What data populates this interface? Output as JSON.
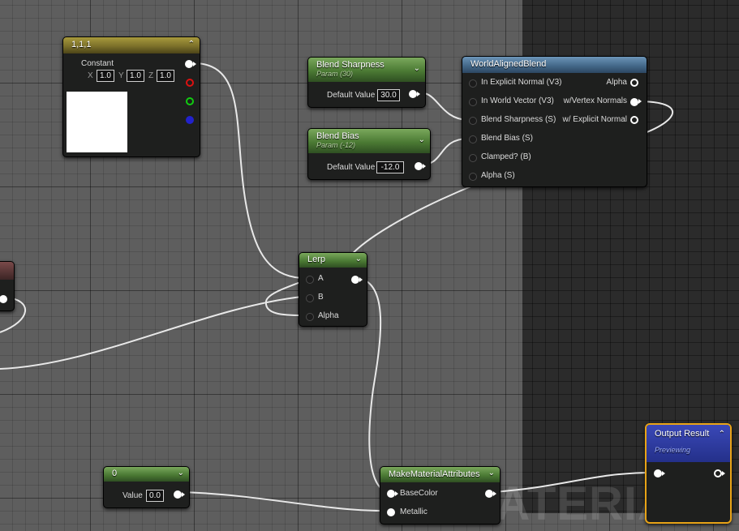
{
  "const3": {
    "title": "1,1,1",
    "subtitle": "Constant",
    "x_label": "X",
    "x_value": "1.0",
    "y_label": "Y",
    "y_value": "1.0",
    "z_label": "Z",
    "z_value": "1.0",
    "swatch_color": "#ffffff"
  },
  "blend_sharpness": {
    "title": "Blend Sharpness",
    "subtitle": "Param (30)",
    "default_label": "Default Value",
    "default_value": "30.0"
  },
  "blend_bias": {
    "title": "Blend Bias",
    "subtitle": "Param (-12)",
    "default_label": "Default Value",
    "default_value": "-12.0"
  },
  "world_aligned_blend": {
    "title": "WorldAlignedBlend",
    "inputs": [
      "In Explicit Normal (V3)",
      "In World Vector (V3)",
      "Blend Sharpness (S)",
      "Blend Bias (S)",
      "Clamped? (B)",
      "Alpha (S)"
    ],
    "outputs": [
      "Alpha",
      "w/Vertex Normals",
      "w/ Explicit Normal"
    ]
  },
  "lerp": {
    "title": "Lerp",
    "inputs": [
      "A",
      "B",
      "Alpha"
    ]
  },
  "scalar_zero": {
    "title": "0",
    "value_label": "Value",
    "value": "0.0"
  },
  "make_material_attributes": {
    "title": "MakeMaterialAttributes",
    "inputs": [
      "BaseColor",
      "Metallic"
    ]
  },
  "output_result": {
    "title": "Output Result",
    "subtitle": "Previewing"
  },
  "watermark_text": "MATERIAL",
  "colors": {
    "green_header": "#4b7a34",
    "olive_header": "#7c702a",
    "blue_header": "#44698a",
    "output_border": "#e8a317",
    "wire": "#e6e6e6"
  }
}
